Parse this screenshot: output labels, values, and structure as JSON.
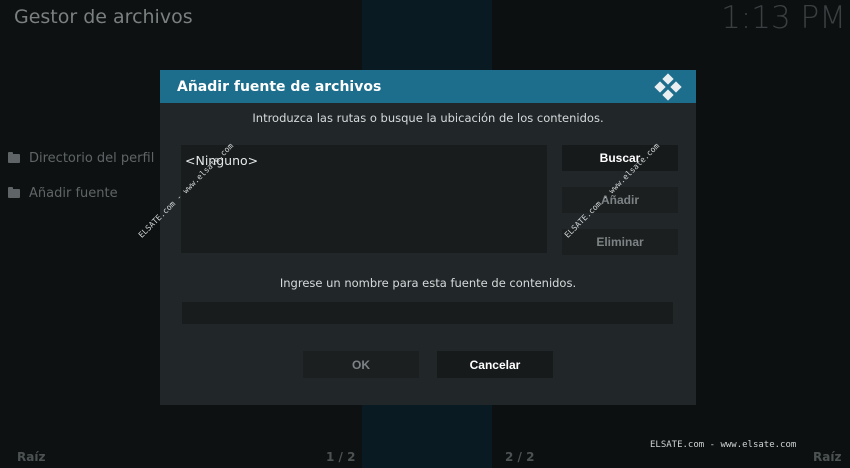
{
  "app": {
    "title": "Gestor de archivos",
    "clock": "1:13 PM"
  },
  "sidebar": {
    "items": [
      {
        "label": "Directorio del perfil",
        "icon": "folder-icon"
      },
      {
        "label": "Añadir fuente",
        "icon": "folder-icon"
      }
    ]
  },
  "footer": {
    "left": "Raíz",
    "page1": "1 / 2",
    "page2": "2 / 2",
    "right": "Raíz",
    "credit": "ELSATE.com - www.elsate.com"
  },
  "dialog": {
    "title": "Añadir fuente de archivos",
    "instruction_paths": "Introduzca las rutas o busque la ubicación de los contenidos.",
    "path_entry": "<Ninguno>",
    "buttons": {
      "browse": "Buscar",
      "add": "Añadir",
      "remove": "Eliminar"
    },
    "instruction_name": "Ingrese un nombre para esta fuente de contenidos.",
    "name_value": "",
    "ok": "OK",
    "cancel": "Cancelar"
  },
  "watermarks": {
    "left": "ELSATE.com - www.elsate.com",
    "right": "ELSATE.com - www.elsate.com"
  },
  "colors": {
    "header": "#1d6e8c",
    "dialog_bg": "#212628",
    "background": "#0e1112"
  }
}
